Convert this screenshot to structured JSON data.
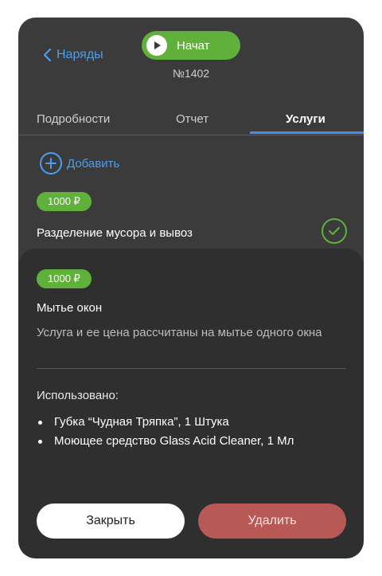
{
  "header": {
    "back_label": "Наряды",
    "start_label": "Начат",
    "order_number": "№1402"
  },
  "tabs": [
    {
      "label": "Подробности",
      "active": false
    },
    {
      "label": "Отчет",
      "active": false
    },
    {
      "label": "Услуги",
      "active": true
    }
  ],
  "add_label": "Добавить",
  "services": [
    {
      "price": "1000 ₽",
      "name": "Разделение мусора и вывоз",
      "completed": true
    }
  ],
  "detail": {
    "price": "1000 ₽",
    "name": "Мытье окон",
    "description": "Услуга и ее цена рассчитаны на мытье одного окна",
    "used_title": "Использовано:",
    "used_items": [
      "Губка “Чудная Тряпка”, 1 Штука",
      "Моющее средство Glass Acid Cleaner, 1 Мл"
    ],
    "close_label": "Закрыть",
    "delete_label": "Удалить"
  },
  "colors": {
    "accent_blue": "#4a9ff0",
    "status_green": "#5fb13b",
    "danger": "#b85955",
    "card_bg": "#3b3b3b",
    "sheet_bg": "#2f2f2f"
  }
}
